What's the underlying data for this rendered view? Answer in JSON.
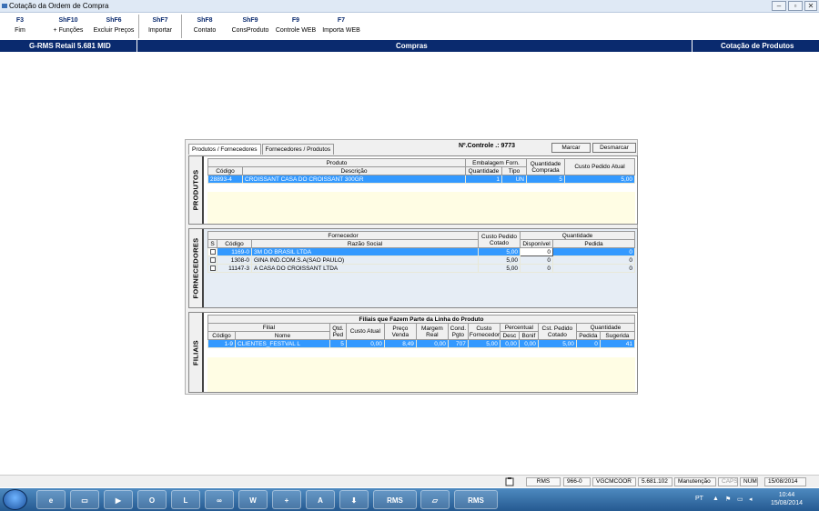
{
  "window": {
    "title": "Cotação da Ordem de Compra"
  },
  "toolbar": [
    {
      "key": "F3",
      "label": "Fim"
    },
    {
      "key": "ShF10",
      "label": "+ Funções"
    },
    {
      "key": "ShF6",
      "label": "Excluir Preços"
    },
    {
      "key": "ShF7",
      "label": "Importar"
    },
    {
      "key": "ShF8",
      "label": "Contato"
    },
    {
      "key": "ShF9",
      "label": "ConsProduto"
    },
    {
      "key": "F9",
      "label": "Controle WEB"
    },
    {
      "key": "F7",
      "label": "Importa WEB"
    }
  ],
  "header": {
    "app": "G-RMS Retail 5.681 MID",
    "module": "Compras",
    "screen": "Cotação de Produtos"
  },
  "tabs": [
    "Produtos / Fornecedores",
    "Fornecedores / Produtos"
  ],
  "controle": "Nº.Controle .: 9773",
  "buttons": {
    "marcar": "Marcar",
    "desmarcar": "Desmarcar"
  },
  "produtos": {
    "label": "PRODUTOS",
    "group_headers": {
      "produto": "Produto",
      "embalagem": "Embalagem Forn.",
      "qtd_comprada": "Quantidade Comprada",
      "custo": "Custo Pedido Atual"
    },
    "columns": {
      "codigo": "Código",
      "descricao": "Descrição",
      "quantidade": "Quantidade",
      "tipo": "Tipo"
    },
    "rows": [
      {
        "codigo": "28893-4",
        "descricao": "CROISSANT CASA DO CROISSANT 300GR",
        "quantidade": "1",
        "tipo": "UN",
        "comprada": "5",
        "custo": "5,00"
      }
    ]
  },
  "fornecedores": {
    "label": "FORNECEDORES",
    "group_headers": {
      "fornecedor": "Fornecedor",
      "custo": "Custo Pedido Cotado",
      "quantidade": "Quantidade"
    },
    "columns": {
      "s": "S",
      "codigo": "Código",
      "razao": "Razão Social",
      "disponivel": "Disponível",
      "pedida": "Pedida"
    },
    "rows": [
      {
        "codigo": "1169-0",
        "razao": "3M DO BRASIL LTDA",
        "custo": "5,00",
        "disponivel": "0",
        "pedida": "0"
      },
      {
        "codigo": "1308-0",
        "razao": "GINA IND.COM.S.A(SAO PAULO)",
        "custo": "5,00",
        "disponivel": "0",
        "pedida": "0"
      },
      {
        "codigo": "11147-3",
        "razao": "A CASA DO CROISSANT LTDA",
        "custo": "5,00",
        "disponivel": "0",
        "pedida": "0"
      }
    ]
  },
  "filiais": {
    "label": "FILIAIS",
    "caption": "Filiais que Fazem Parte da Linha do Produto",
    "group_headers": {
      "filial": "Filial",
      "percentual": "Percentual",
      "quantidade": "Quantidade"
    },
    "columns": {
      "codigo": "Código",
      "nome": "Nome",
      "qtd_ped": "Qtd. Ped",
      "custo_atual": "Custo Atual",
      "preco_venda": "Preço Venda",
      "margem_real": "Margem Real",
      "cond_pgto": "Cond. Pgto",
      "custo_forn": "Custo Fornecedor",
      "desc": "Desc",
      "bonif": "Bonif",
      "cst_pedido": "Cst. Pedido Cotado",
      "pedida": "Pedida",
      "sugerida": "Sugerida"
    },
    "rows": [
      {
        "codigo": "1-9",
        "nome": "CLIENTES_FESTVAL L",
        "qtd_ped": "5",
        "custo_atual": "0,00",
        "preco_venda": "8,49",
        "margem_real": "0,00",
        "cond_pgto": "707",
        "custo_forn": "5,00",
        "desc": "0,00",
        "bonif": "0,00",
        "cst_pedido": "5,00",
        "pedida": "0",
        "sugerida": "41"
      }
    ]
  },
  "statusbar": [
    "RMS",
    "966-0",
    "VGCMCOOR",
    "5.681.102",
    "Manutenção",
    "CAPS",
    "NUM",
    "15/08/2014"
  ],
  "taskbar": {
    "time": "10:44",
    "date": "15/08/2014",
    "lang": "PT",
    "rms1": "RMS",
    "rms2": "RMS"
  }
}
